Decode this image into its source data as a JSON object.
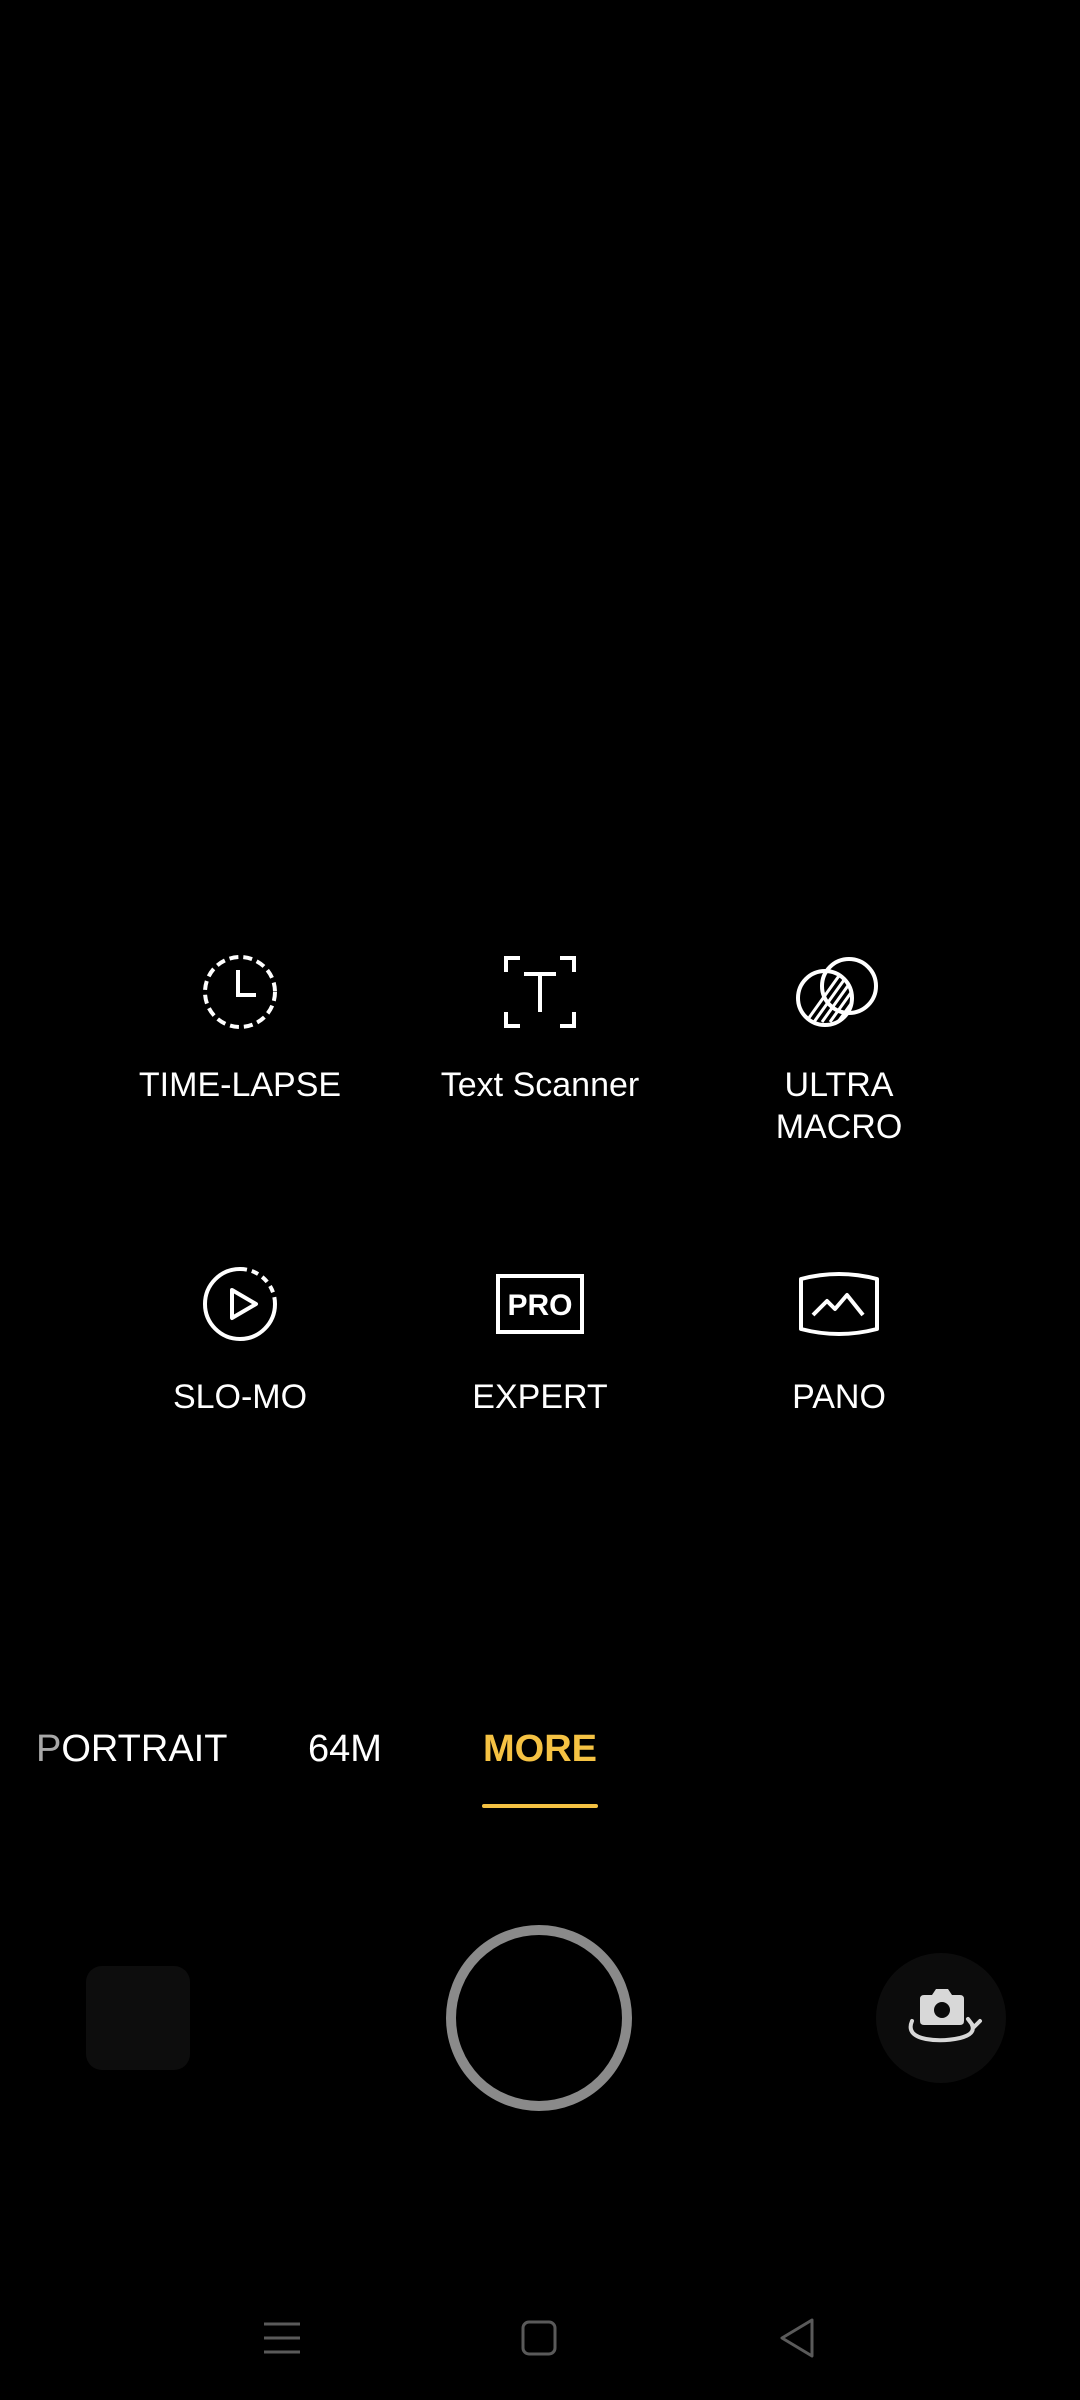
{
  "modes": [
    {
      "label": "TIME-LAPSE",
      "icon": "timer-icon"
    },
    {
      "label": "Text Scanner",
      "icon": "text-scanner-icon"
    },
    {
      "label": "ULTRA\nMACRO",
      "icon": "ultra-macro-icon"
    },
    {
      "label": "SLO-MO",
      "icon": "slow-motion-icon"
    },
    {
      "label": "EXPERT",
      "icon": "pro-icon"
    },
    {
      "label": "PANO",
      "icon": "panorama-icon"
    }
  ],
  "expert_icon_text": "PRO",
  "mode_tabs": {
    "portrait_first": "P",
    "portrait_rest": "ORTRAIT",
    "megapixel": "64M",
    "more": "MORE",
    "selected": "MORE"
  },
  "colors": {
    "background": "#000000",
    "accent": "#F5C243",
    "text": "#FFFFFF",
    "shutter_ring": "#8A8A8A",
    "nav_icon": "#5A5A5A"
  },
  "icons": {
    "flip_camera": "camera-flip-icon",
    "nav_menu": "menu-icon",
    "nav_home": "home-icon",
    "nav_back": "back-icon"
  }
}
